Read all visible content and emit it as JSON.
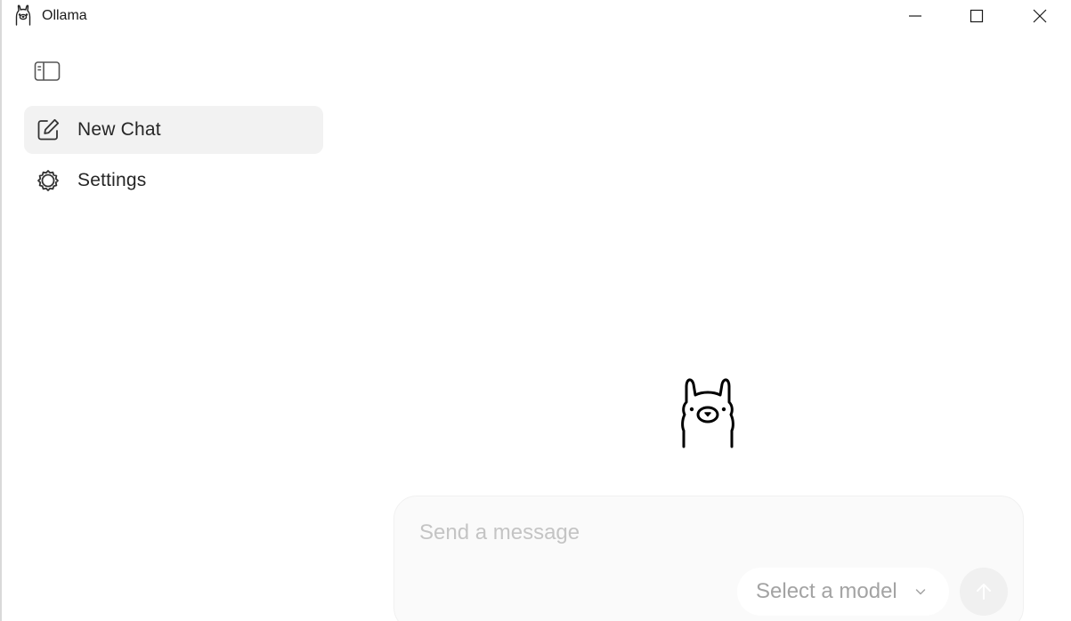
{
  "window": {
    "title": "Ollama",
    "icons": {
      "app": "llama-icon",
      "minimize": "minimize-icon",
      "maximize": "maximize-icon",
      "close": "close-icon"
    }
  },
  "sidebar": {
    "toggle_icon": "sidebar-toggle-icon",
    "items": [
      {
        "label": "New Chat",
        "icon": "compose-icon",
        "active": true
      },
      {
        "label": "Settings",
        "icon": "gear-icon",
        "active": false
      }
    ]
  },
  "main": {
    "logo": "llama-logo"
  },
  "composer": {
    "placeholder": "Send a message",
    "value": "",
    "model_select_label": "Select a model",
    "send_icon": "arrow-up-icon"
  },
  "colors": {
    "active_item_bg": "#f2f2f2",
    "composer_bg": "#fafafa",
    "placeholder": "#c4c4c4",
    "send_button_bg": "#f0f0f0"
  }
}
